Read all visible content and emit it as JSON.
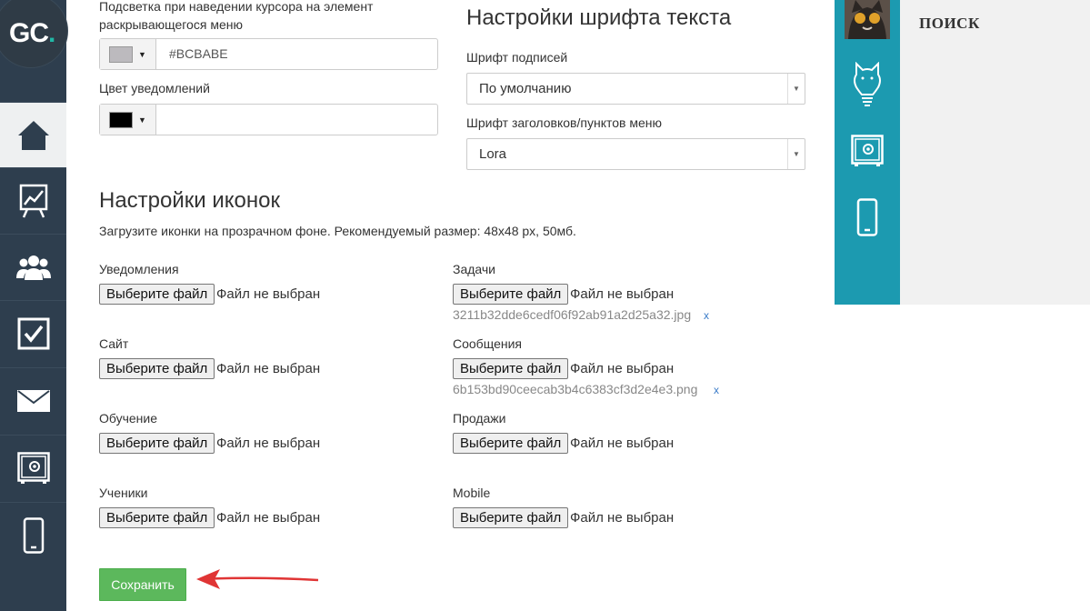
{
  "logo": {
    "text": "GC",
    "dot": "."
  },
  "sidebar": {
    "items": [
      {
        "icon": "home-icon",
        "active": true
      },
      {
        "icon": "chart-icon"
      },
      {
        "icon": "users-icon"
      },
      {
        "icon": "tasks-icon"
      },
      {
        "icon": "mail-icon"
      },
      {
        "icon": "safe-icon"
      },
      {
        "icon": "mobile-icon"
      }
    ]
  },
  "colors": {
    "hover_label": "Подсветка при наведении курсора на элемент раскрывающегося меню",
    "hover_value": "#BCBABE",
    "hover_swatch": "#BCBABE",
    "notif_label": "Цвет уведомлений",
    "notif_value": "",
    "notif_swatch": "#000000"
  },
  "fonts": {
    "title": "Настройки шрифта текста",
    "caption_label": "Шрифт подписей",
    "caption_value": "По умолчанию",
    "heading_label": "Шрифт заголовков/пунктов меню",
    "heading_value": "Lora"
  },
  "icons": {
    "title": "Настройки иконок",
    "hint": "Загрузите иконки на прозрачном фоне. Рекомендуемый размер: 48x48 px, 50мб.",
    "button_label": "Выберите файл",
    "no_file": "Файл не выбран",
    "fields": [
      {
        "label": "Уведомления"
      },
      {
        "label": "Задачи",
        "file": "3211b32dde6cedf06f92ab91a2d25a32.jpg",
        "remove": "x"
      },
      {
        "label": "Сайт"
      },
      {
        "label": "Сообщения",
        "file": "6b153bd90ceecab3b4c6383cf3d2e4e3.png",
        "remove": "x"
      },
      {
        "label": "Обучение"
      },
      {
        "label": "Продажи"
      },
      {
        "label": "Ученики"
      },
      {
        "label": "Mobile"
      }
    ]
  },
  "save_label": "Сохранить",
  "right_panel": {
    "search_label": "ПОИСК",
    "icons": [
      "avatar",
      "cat-bulb-icon",
      "safe-icon",
      "mobile-icon"
    ],
    "teal": "#1c9ab0"
  },
  "accent": {
    "save": "#5cb85c",
    "arrow": "#e03535",
    "sidebar": "#2e3e4e"
  }
}
